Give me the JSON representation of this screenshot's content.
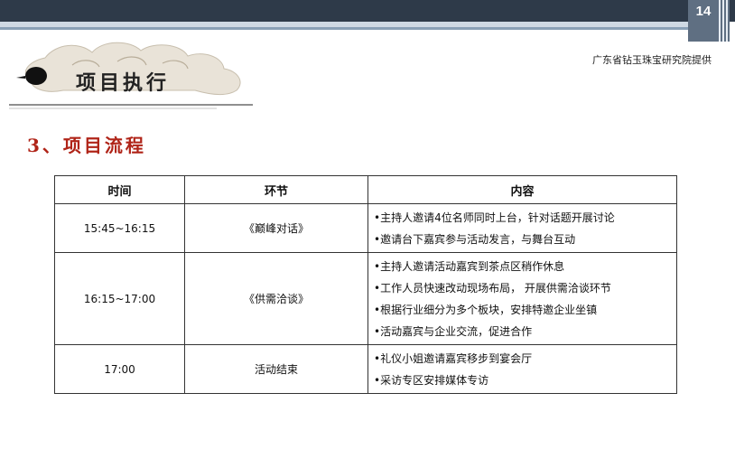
{
  "slide": {
    "page_number": "14"
  },
  "header": {
    "section_title": "项目执行",
    "source_credit": "广东省钻玉珠宝研究院提供"
  },
  "subsection_title": "3、项目流程",
  "table": {
    "headers": [
      "时间",
      "环节",
      "内容"
    ],
    "rows": [
      {
        "time": "15:45~16:15",
        "segment": "《巅峰对话》",
        "contents": [
          "•主持人邀请4位名师同时上台，针对话题开展讨论",
          "•邀请台下嘉宾参与活动发言，与舞台互动"
        ]
      },
      {
        "time": "16:15~17:00",
        "segment": "《供需洽谈》",
        "contents": [
          "•主持人邀请活动嘉宾到茶点区稍作休息",
          "•工作人员快速改动现场布局， 开展供需洽谈环节",
          "•根据行业细分为多个板块，安排特邀企业坐镇",
          "•活动嘉宾与企业交流，促进合作"
        ]
      },
      {
        "time": "17:00",
        "segment": "活动结束",
        "contents": [
          "•礼仪小姐邀请嘉宾移步到宴会厅",
          "•采访专区安排媒体专访"
        ]
      }
    ]
  },
  "colors": {
    "header_bar": "#2e3a49",
    "accent_red": "#b02418"
  },
  "icons": {
    "decoration": "ink-cloud-icon",
    "bullet": "ink-dot-icon"
  }
}
